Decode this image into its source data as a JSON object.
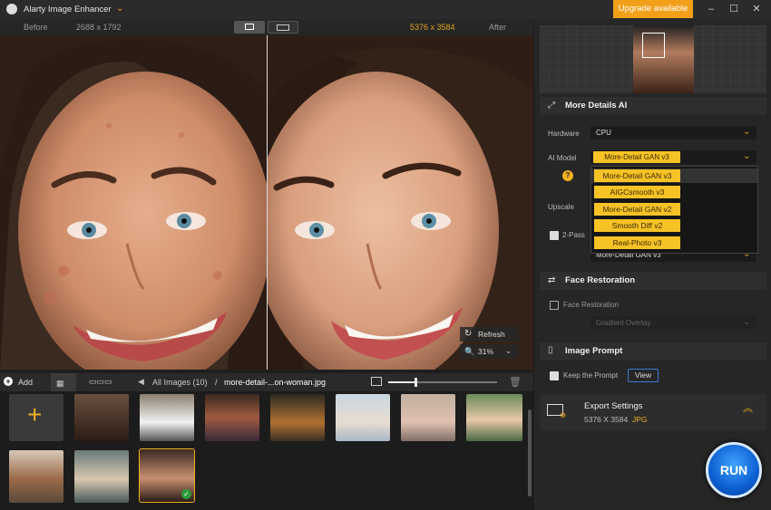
{
  "app": {
    "title": "Alarty Image Enhancer",
    "upgrade_label": "Upgrade available"
  },
  "compare": {
    "before_label": "Before",
    "before_size": "2688 x 1792",
    "after_size": "5376 x 3584",
    "after_label": "After"
  },
  "preview": {
    "refresh_label": "Refresh",
    "zoom": "31%"
  },
  "thumbs": {
    "add_label": "Add",
    "all_images": "All Images (10)",
    "slash": "/",
    "filename": "more-detail-...on-woman.jpg"
  },
  "panel": {
    "more_details": {
      "title": "More Details AI",
      "hardware_label": "Hardware",
      "hardware_value": "CPU",
      "ai_model_label": "AI Model",
      "ai_model_value": "More-Detail GAN  v3",
      "upscale_label": "Upscale",
      "two_pass_label": "2-Pass",
      "two_pass_value": "More-Detail GAN  v3"
    },
    "dropdown_options": [
      "More-Detail GAN  v3",
      "AIGCsmooth  v3",
      "More-Detail GAN  v2",
      "Smooth Diff  v2",
      "Real-Photo  v3"
    ],
    "face": {
      "title": "Face Restoration",
      "checkbox_label": "Face Restoration",
      "select_value": "Gradient Overlay"
    },
    "prompt": {
      "title": "Image Prompt",
      "checkbox_label": "Keep the Prompt",
      "view_label": "View"
    },
    "export": {
      "title": "Export Settings",
      "size": "5376 X 3584",
      "format": "JPG"
    },
    "run_label": "RUN"
  },
  "colors": {
    "accent": "#f2a01a",
    "run_blue": "#1a6fe0",
    "dropdown_item": "#f6c226"
  }
}
